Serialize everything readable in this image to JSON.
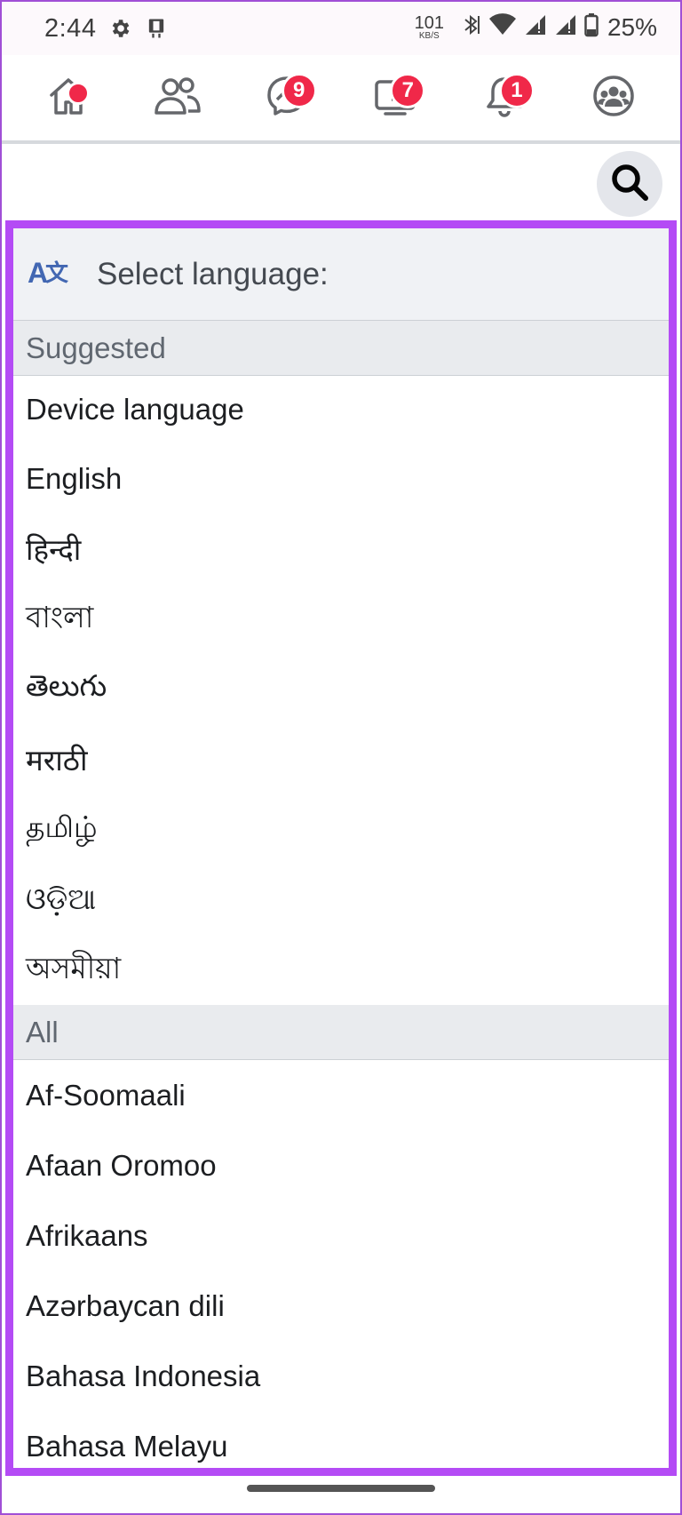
{
  "status_bar": {
    "time": "2:44",
    "net_speed_value": "101",
    "net_speed_unit": "KB/S",
    "battery": "25%",
    "icons": [
      "settings-icon",
      "device-icon",
      "bluetooth-icon",
      "wifi-icon",
      "signal-icon",
      "signal-icon",
      "battery-icon"
    ]
  },
  "nav": {
    "items": [
      {
        "name": "home",
        "icon": "home-icon",
        "badge": ""
      },
      {
        "name": "friends",
        "icon": "friends-icon",
        "badge": ""
      },
      {
        "name": "messenger",
        "icon": "messenger-icon",
        "badge": "9"
      },
      {
        "name": "watch",
        "icon": "video-icon",
        "badge": "7"
      },
      {
        "name": "notifications",
        "icon": "bell-icon",
        "badge": "1"
      },
      {
        "name": "groups",
        "icon": "groups-icon",
        "badge": ""
      }
    ]
  },
  "language_panel": {
    "title": "Select language:",
    "suggested_label": "Suggested",
    "suggested": [
      "Device language",
      "English",
      "हिन्दी",
      "বাংলা",
      "తెలుగు",
      "मराठी",
      "தமிழ்",
      "ଓଡ଼ିଆ",
      "অসমীয়া"
    ],
    "all_label": "All",
    "all": [
      "Af-Soomaali",
      "Afaan Oromoo",
      "Afrikaans",
      "Azərbaycan dili",
      "Bahasa Indonesia",
      "Bahasa Melayu"
    ]
  },
  "colors": {
    "accent_highlight": "#b44bf5",
    "badge": "#f02849",
    "translate_icon": "#4267b2"
  }
}
